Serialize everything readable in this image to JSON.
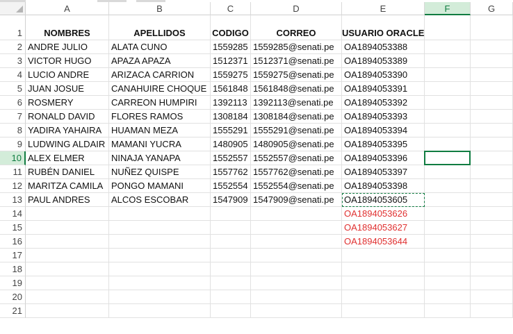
{
  "columns": [
    "A",
    "B",
    "C",
    "D",
    "E",
    "F",
    "G"
  ],
  "selected_column": "F",
  "selected_row": "10",
  "rows": [
    "1",
    "2",
    "3",
    "4",
    "5",
    "6",
    "7",
    "8",
    "9",
    "10",
    "11",
    "12",
    "13",
    "14",
    "15",
    "16",
    "17",
    "18",
    "19",
    "20",
    "21"
  ],
  "headers": {
    "a": "NOMBRES",
    "b": "APELLIDOS",
    "c": "CODIGO",
    "d": "CORREO",
    "e": "USUARIO ORACLE"
  },
  "data_rows": [
    {
      "a": "ANDRE JULIO",
      "b": "ALATA CUNO",
      "c": "1559285",
      "d": "1559285@senati.pe",
      "e": "OA1894053388"
    },
    {
      "a": "VICTOR HUGO",
      "b": "APAZA APAZA",
      "c": "1512371",
      "d": "1512371@senati.pe",
      "e": "OA1894053389"
    },
    {
      "a": "LUCIO ANDRE",
      "b": "ARIZACA CARRION",
      "c": "1559275",
      "d": "1559275@senati.pe",
      "e": "OA1894053390"
    },
    {
      "a": "JUAN JOSUE",
      "b": "CANAHUIRE CHOQUE",
      "c": "1561848",
      "d": "1561848@senati.pe",
      "e": "OA1894053391"
    },
    {
      "a": "ROSMERY",
      "b": "CARREON HUMPIRI",
      "c": "1392113",
      "d": "1392113@senati.pe",
      "e": "OA1894053392"
    },
    {
      "a": "RONALD DAVID",
      "b": "FLORES RAMOS",
      "c": "1308184",
      "d": "1308184@senati.pe",
      "e": "OA1894053393"
    },
    {
      "a": "YADIRA YAHAIRA",
      "b": "HUAMAN MEZA",
      "c": "1555291",
      "d": "1555291@senati.pe",
      "e": "OA1894053394"
    },
    {
      "a": "LUDWING ALDAIR",
      "b": "MAMANI YUCRA",
      "c": "1480905",
      "d": "1480905@senati.pe",
      "e": "OA1894053395"
    },
    {
      "a": "ALEX ELMER",
      "b": "NINAJA YANAPA",
      "c": "1552557",
      "d": "1552557@senati.pe",
      "e": "OA1894053396"
    },
    {
      "a": "RUBÉN DANIEL",
      "b": "NUÑEZ QUISPE",
      "c": "1557762",
      "d": "1557762@senati.pe",
      "e": "OA1894053397"
    },
    {
      "a": "MARITZA CAMILA",
      "b": "PONGO MAMANI",
      "c": "1552554",
      "d": "1552554@senati.pe",
      "e": "OA1894053398"
    },
    {
      "a": "PAUL ANDRES",
      "b": "ALCOS ESCOBAR",
      "c": "1547909",
      "d": "1547909@senati.pe",
      "e": "OA1894053605"
    }
  ],
  "extra_rows": [
    {
      "e": "OA1894053626"
    },
    {
      "e": "OA1894053627"
    },
    {
      "e": "OA1894053644"
    }
  ],
  "colors": {
    "selection_accent": "#107c41",
    "red_text": "#e03030"
  }
}
